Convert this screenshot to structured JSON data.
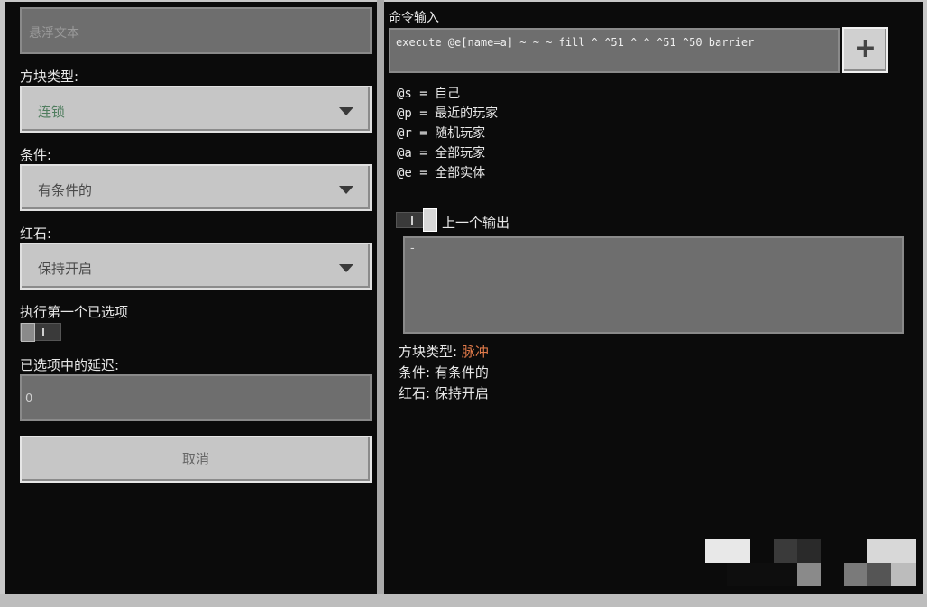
{
  "left": {
    "hover_text_placeholder": "悬浮文本",
    "block_type_label": "方块类型:",
    "block_type_value": "连锁",
    "condition_label": "条件:",
    "condition_value": "有条件的",
    "redstone_label": "红石:",
    "redstone_value": "保持开启",
    "execute_first_label": "执行第一个已选项",
    "delay_label": "已选项中的延迟:",
    "delay_value": "0",
    "cancel_label": "取消"
  },
  "right": {
    "command_input_label": "命令输入",
    "command_value": "execute @e[name=a] ~ ~ ~ fill ^ ^51 ^ ^ ^51 ^50 barrier",
    "add_button_glyph": "+",
    "selectors": [
      {
        "code": "@s",
        "eq": "=",
        "desc": "自己"
      },
      {
        "code": "@p",
        "eq": "=",
        "desc": "最近的玩家"
      },
      {
        "code": "@r",
        "eq": "=",
        "desc": "随机玩家"
      },
      {
        "code": "@a",
        "eq": "=",
        "desc": "全部玩家"
      },
      {
        "code": "@e",
        "eq": "=",
        "desc": "全部实体"
      }
    ],
    "previous_output_label": "上一个输出",
    "previous_output_value": "-",
    "summary": {
      "block_type_key": "方块类型:",
      "block_type_value": "脉冲",
      "condition_key": "条件:",
      "condition_value": "有条件的",
      "redstone_key": "红石:",
      "redstone_value": "保持开启"
    }
  },
  "colors": {
    "panel_bg": "#0b0b0b",
    "button_bg": "#c6c6c6",
    "field_bg": "#6e6e6e",
    "accent_orange": "#e07a4a",
    "select_value_green": "#4f7d5e"
  }
}
